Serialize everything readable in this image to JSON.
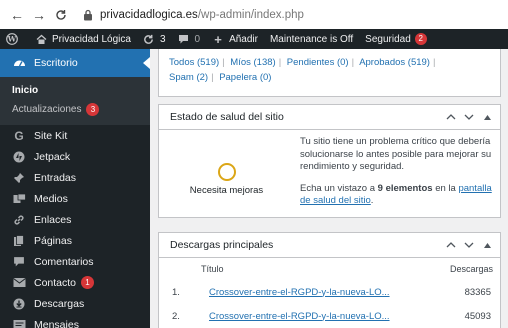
{
  "browser": {
    "url_domain": "privacidadlogica.es",
    "url_path": "/wp-admin/index.php"
  },
  "adminbar": {
    "site_name": "Privacidad Lógica",
    "updates_count": "3",
    "comments_count": "0",
    "add_label": "Añadir",
    "maintenance_label": "Maintenance is Off",
    "security_label": "Seguridad",
    "security_count": "2"
  },
  "sidebar": {
    "dashboard_label": "Escritorio",
    "home_label": "Inicio",
    "updates_label": "Actualizaciones",
    "updates_badge": "3",
    "items": [
      {
        "label": "Site Kit",
        "icon": "g-icon"
      },
      {
        "label": "Jetpack",
        "icon": "jetpack-icon"
      },
      {
        "label": "Entradas",
        "icon": "pin-icon"
      },
      {
        "label": "Medios",
        "icon": "media-icon"
      },
      {
        "label": "Enlaces",
        "icon": "link-icon"
      },
      {
        "label": "Páginas",
        "icon": "pages-icon"
      },
      {
        "label": "Comentarios",
        "icon": "comment-icon"
      },
      {
        "label": "Contacto",
        "icon": "mail-icon",
        "badge": "1"
      },
      {
        "label": "Descargas",
        "icon": "download-icon"
      },
      {
        "label": "Mensajes",
        "icon": "messages-icon"
      }
    ]
  },
  "comments_filters": {
    "all": "Todos (519)",
    "mine": "Míos (138)",
    "pending": "Pendientes (0)",
    "approved": "Aprobados (519)",
    "spam": "Spam (2)",
    "trash": "Papelera (0)"
  },
  "health": {
    "title": "Estado de salud del sitio",
    "status": "Necesita mejoras",
    "message": "Tu sitio tiene un problema crítico que debería solucionarse lo antes posible para mejorar su rendimiento y seguridad.",
    "cta_prefix": "Echa un vistazo a ",
    "cta_count": "9 elementos",
    "cta_middle": " en la ",
    "cta_link": "pantalla de salud del sitio",
    "cta_suffix": "."
  },
  "downloads": {
    "title": "Descargas principales",
    "col_title": "Título",
    "col_downloads": "Descargas",
    "rows": [
      {
        "num": "1.",
        "title": "Crossover-entre-el-RGPD-y-la-nueva-LO...",
        "count": "83365"
      },
      {
        "num": "2.",
        "title": "Crossover-entre-el-RGPD-y-la-nueva-LO...",
        "count": "45093"
      }
    ]
  },
  "colors": {
    "adminbar": "#1d2327",
    "accent": "#2271b1",
    "badge": "#d63638",
    "warning": "#dba617"
  }
}
